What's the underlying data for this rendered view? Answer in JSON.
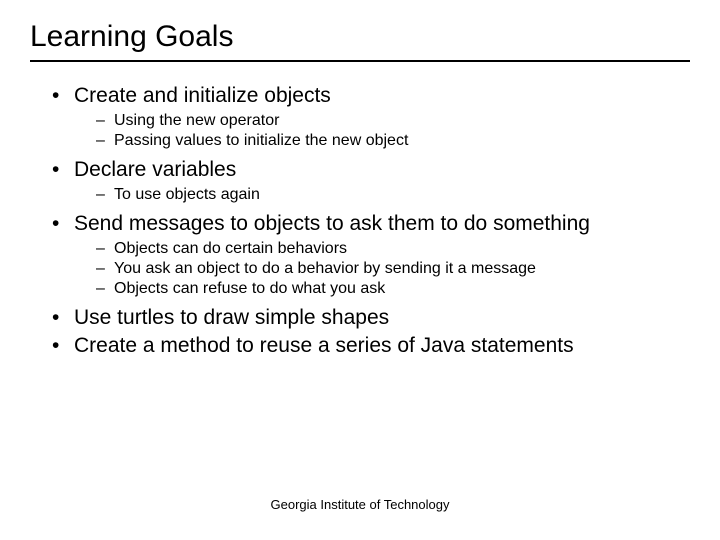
{
  "title": "Learning Goals",
  "bullets": [
    {
      "text": "Create and initialize objects",
      "sub": [
        "Using the new operator",
        "Passing values to initialize the new object"
      ]
    },
    {
      "text": "Declare variables",
      "sub": [
        "To use objects again"
      ]
    },
    {
      "text": "Send messages to objects to ask them to do something",
      "sub": [
        "Objects can do certain behaviors",
        "You ask an object to do a behavior by sending it a message",
        "Objects can refuse to do what you ask"
      ]
    },
    {
      "text": "Use turtles to draw simple shapes",
      "sub": []
    },
    {
      "text": "Create a method to reuse a series of Java statements",
      "sub": []
    }
  ],
  "footer": "Georgia Institute of Technology"
}
